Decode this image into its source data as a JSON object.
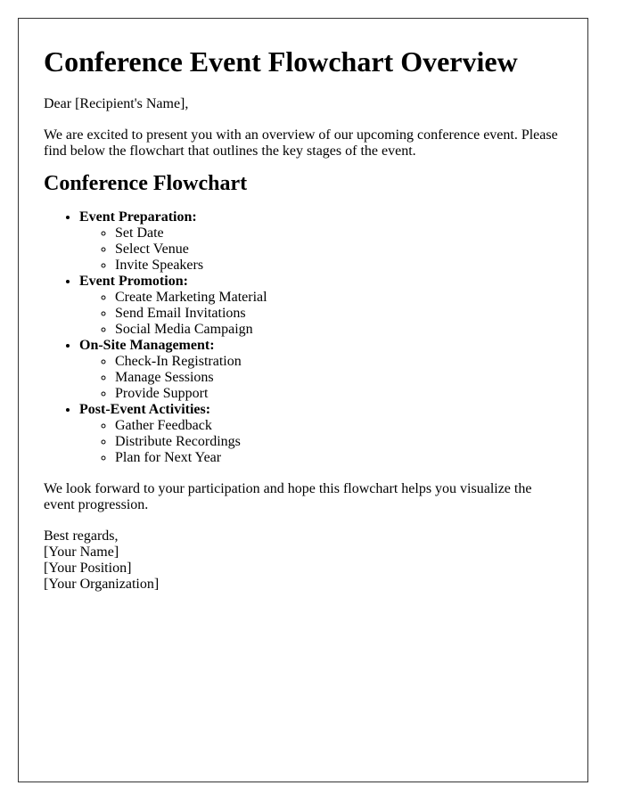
{
  "document": {
    "title": "Conference Event Flowchart Overview",
    "greeting": "Dear [Recipient's Name],",
    "intro": "We are excited to present you with an overview of our upcoming conference event. Please find below the flowchart that outlines the key stages of the event.",
    "section_heading": "Conference Flowchart",
    "stages": [
      {
        "label": "Event Preparation:",
        "tasks": [
          "Set Date",
          "Select Venue",
          "Invite Speakers"
        ]
      },
      {
        "label": "Event Promotion:",
        "tasks": [
          "Create Marketing Material",
          "Send Email Invitations",
          "Social Media Campaign"
        ]
      },
      {
        "label": "On-Site Management:",
        "tasks": [
          "Check-In Registration",
          "Manage Sessions",
          "Provide Support"
        ]
      },
      {
        "label": "Post-Event Activities:",
        "tasks": [
          "Gather Feedback",
          "Distribute Recordings",
          "Plan for Next Year"
        ]
      }
    ],
    "closing": "We look forward to your participation and hope this flowchart helps you visualize the event progression.",
    "signoff": {
      "regards": "Best regards,",
      "name": "[Your Name]",
      "position": "[Your Position]",
      "organization": "[Your Organization]"
    }
  }
}
